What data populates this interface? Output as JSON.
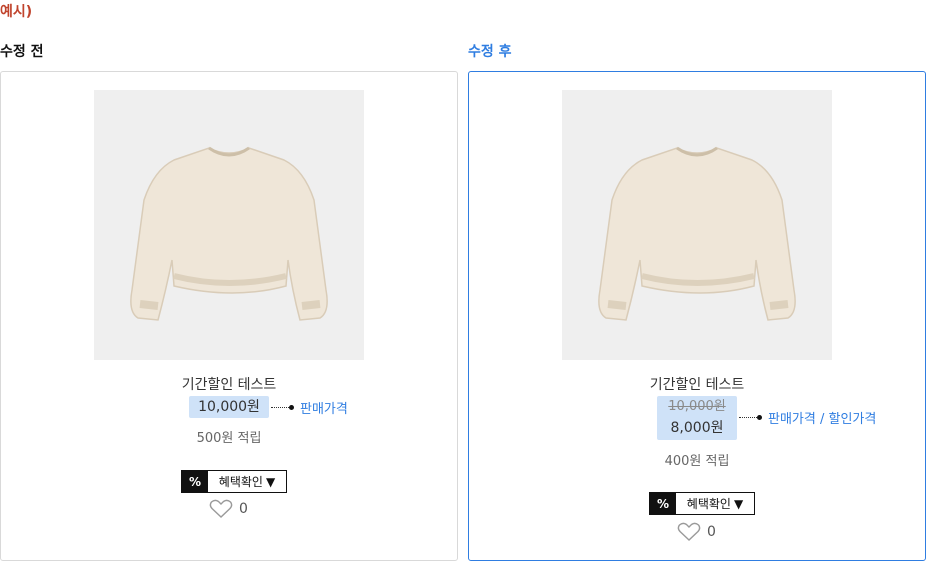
{
  "example_label": "예시)",
  "before": {
    "title": "수정 전",
    "product_name": "기간할인 테스트",
    "price": "10,000원",
    "price_callout": "판매가격",
    "points": "500원 적립",
    "benefit_pct": "%",
    "benefit_label": "혜택확인",
    "benefit_arrow": "▼",
    "likes": "0"
  },
  "after": {
    "title": "수정 후",
    "product_name": "기간할인 테스트",
    "original_price": "10,000원",
    "sale_price": "8,000원",
    "price_callout": "판매가격 / 할인가격",
    "points": "400원 적립",
    "benefit_pct": "%",
    "benefit_label": "혜택확인",
    "benefit_arrow": "▼",
    "likes": "0"
  },
  "icons": {
    "heart": "heart-outline-icon",
    "dropdown": "triangle-down-icon"
  },
  "colors": {
    "accent": "#2f7de1",
    "example_label": "#c0442d",
    "price_highlight": "#cfe2f8"
  }
}
